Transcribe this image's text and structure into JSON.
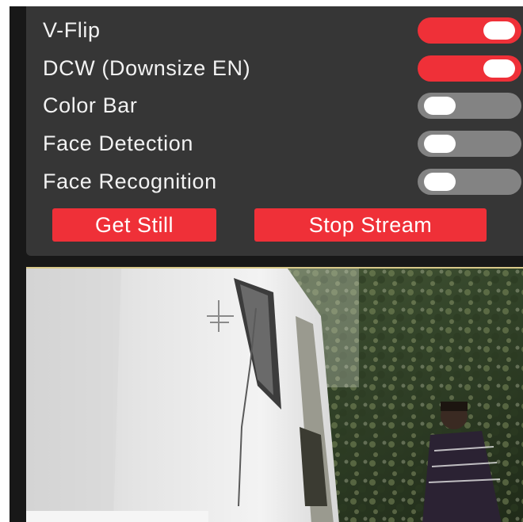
{
  "settings": {
    "toggles": [
      {
        "label": "V-Flip",
        "on": true
      },
      {
        "label": "DCW (Downsize EN)",
        "on": true
      },
      {
        "label": "Color Bar",
        "on": false
      },
      {
        "label": "Face Detection",
        "on": false
      },
      {
        "label": "Face Recognition",
        "on": false
      }
    ]
  },
  "buttons": {
    "get_still": "Get Still",
    "stop_stream": "Stop Stream"
  },
  "colors": {
    "accent": "#ef3038",
    "panel": "#363636",
    "toggle_off": "#838383"
  },
  "stream": {
    "icon": "camera-stream-image"
  }
}
